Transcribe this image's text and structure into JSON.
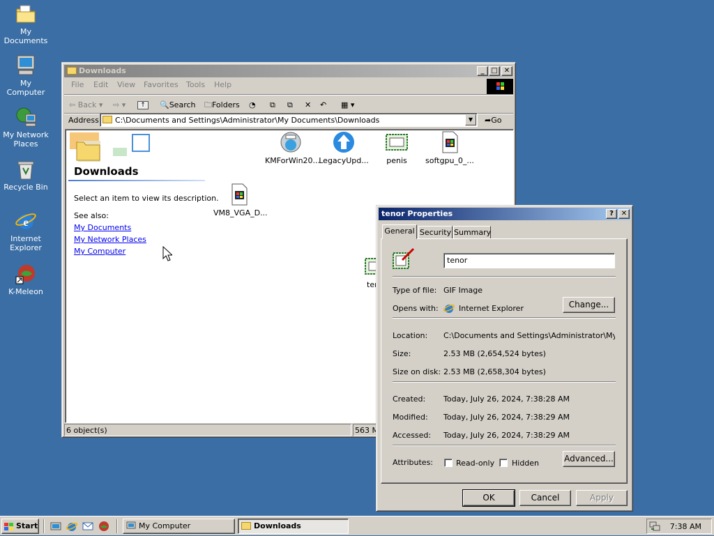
{
  "desktop": {
    "icons": [
      {
        "label": "My Documents",
        "icon": "folder-documents-icon"
      },
      {
        "label": "My Computer",
        "icon": "computer-icon"
      },
      {
        "label": "My Network Places",
        "icon": "network-icon"
      },
      {
        "label": "Recycle Bin",
        "icon": "recycle-bin-icon"
      },
      {
        "label": "Internet Explorer",
        "icon": "ie-icon"
      },
      {
        "label": "K-Meleon",
        "icon": "kmeleon-icon"
      }
    ]
  },
  "explorer": {
    "title": "Downloads",
    "menu": [
      "File",
      "Edit",
      "View",
      "Favorites",
      "Tools",
      "Help"
    ],
    "toolbar": {
      "back": "Back",
      "search": "Search",
      "folders": "Folders"
    },
    "address_label": "Address",
    "address_value": "C:\\Documents and Settings\\Administrator\\My Documents\\Downloads",
    "go": "Go",
    "side": {
      "heading": "Downloads",
      "description": "Select an item to view its description.",
      "see_also": "See also:",
      "links": [
        "My Documents",
        "My Network Places",
        "My Computer"
      ]
    },
    "files": [
      {
        "name": "KMForWin20...",
        "icon": "km-installer-icon"
      },
      {
        "name": "LegacyUpd...",
        "icon": "legacy-update-icon"
      },
      {
        "name": "penis",
        "icon": "gif-image-icon"
      },
      {
        "name": "softgpu_0_...",
        "icon": "media-file-icon"
      },
      {
        "name": "VM8_VGA_D...",
        "icon": "media-file-icon"
      },
      {
        "name": "ten",
        "icon": "gif-image-icon"
      }
    ],
    "status_objects": "6 object(s)",
    "status_size": "563 M"
  },
  "properties": {
    "title": "tenor Properties",
    "tabs": [
      "General",
      "Security",
      "Summary"
    ],
    "active_tab": "General",
    "filename": "tenor",
    "type_label": "Type of file:",
    "type_value": "GIF Image",
    "opens_label": "Opens with:",
    "opens_value": "Internet Explorer",
    "change_btn": "Change...",
    "location_label": "Location:",
    "location_value": "C:\\Documents and Settings\\Administrator\\My Docu",
    "size_label": "Size:",
    "size_value": "2.53 MB (2,654,524 bytes)",
    "size_disk_label": "Size on disk:",
    "size_disk_value": "2.53 MB (2,658,304 bytes)",
    "created_label": "Created:",
    "created_value": "Today, July 26, 2024, 7:38:28 AM",
    "modified_label": "Modified:",
    "modified_value": "Today, July 26, 2024, 7:38:29 AM",
    "accessed_label": "Accessed:",
    "accessed_value": "Today, July 26, 2024, 7:38:29 AM",
    "attributes_label": "Attributes:",
    "readonly_label": "Read-only",
    "hidden_label": "Hidden",
    "readonly_checked": false,
    "hidden_checked": false,
    "advanced_btn": "Advanced...",
    "ok_btn": "OK",
    "cancel_btn": "Cancel",
    "apply_btn": "Apply"
  },
  "taskbar": {
    "start": "Start",
    "tasks": [
      {
        "label": "My Computer",
        "active": false
      },
      {
        "label": "Downloads",
        "active": true
      }
    ],
    "clock": "7:38 AM"
  }
}
